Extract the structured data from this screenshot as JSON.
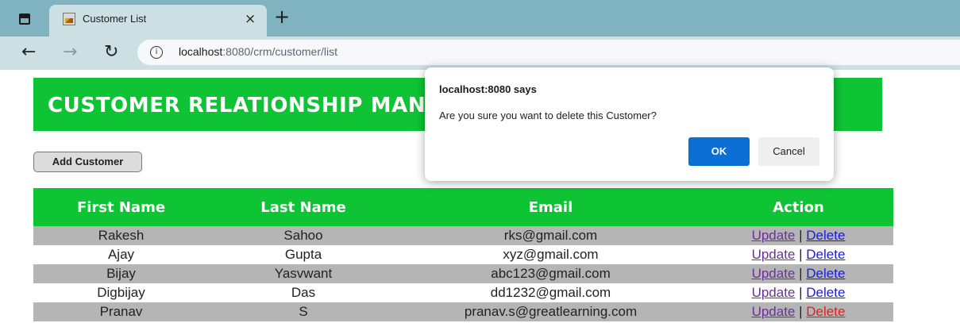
{
  "browser": {
    "tab_title": "Customer List",
    "tab_close": "×",
    "new_tab": "+",
    "url_host": "localhost",
    "url_path": ":8080/crm/customer/list",
    "back_icon": "←",
    "forward_icon": "→",
    "reload_icon": "↻",
    "info_icon": "i"
  },
  "page": {
    "heading": "CUSTOMER RELATIONSHIP MANAGER",
    "add_button": "Add Customer",
    "columns": [
      "First Name",
      "Last Name",
      "Email",
      "Action"
    ],
    "rows": [
      {
        "first": "Rakesh",
        "last": "Sahoo",
        "email": "rks@gmail.com"
      },
      {
        "first": "Ajay",
        "last": "Gupta",
        "email": "xyz@gmail.com"
      },
      {
        "first": "Bijay",
        "last": "Yasvwant",
        "email": "abc123@gmail.com"
      },
      {
        "first": "Digbijay",
        "last": "Das",
        "email": "dd1232@gmail.com"
      },
      {
        "first": "Pranav",
        "last": "S",
        "email": "pranav.s@greatlearning.com"
      }
    ],
    "update_label": "Update",
    "delete_label": "Delete",
    "separator": "|"
  },
  "dialog": {
    "title": "localhost:8080 says",
    "message": "Are you sure you want to delete this Customer?",
    "ok": "OK",
    "cancel": "Cancel"
  },
  "colors": {
    "banner_green": "#0ec434",
    "row_gray": "#b5b5b5",
    "ok_blue": "#0b6fd6",
    "tabstrip": "#7fb3c0"
  }
}
